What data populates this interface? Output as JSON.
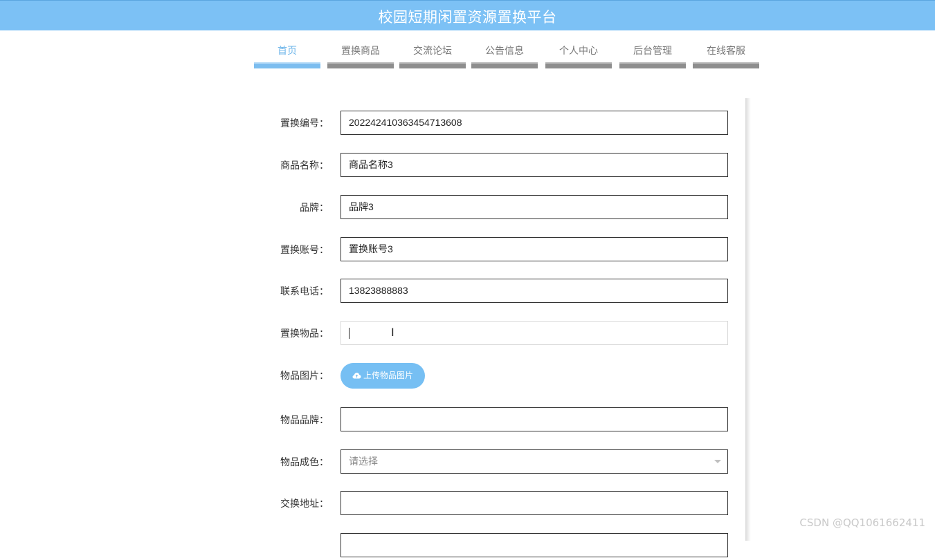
{
  "header": {
    "title": "校园短期闲置资源置换平台"
  },
  "nav": {
    "items": [
      {
        "label": "首页",
        "active": true
      },
      {
        "label": "置换商品"
      },
      {
        "label": "交流论坛"
      },
      {
        "label": "公告信息"
      },
      {
        "label": "个人中心"
      },
      {
        "label": "后台管理"
      },
      {
        "label": "在线客服"
      }
    ]
  },
  "form": {
    "exchange_no": {
      "label": "置换编号：",
      "value": "2022424103634547136​08"
    },
    "product_name": {
      "label": "商品名称：",
      "value": "商品名称3"
    },
    "brand": {
      "label": "品牌：",
      "value": "品牌3"
    },
    "exchange_account": {
      "label": "置换账号：",
      "value": "置换账号3"
    },
    "phone": {
      "label": "联系电话：",
      "value": "13823888883"
    },
    "exchange_item": {
      "label": "置换物品：",
      "value": ""
    },
    "item_image": {
      "label": "物品图片：",
      "button_label": "上传物品图片"
    },
    "item_brand": {
      "label": "物品品牌：",
      "value": ""
    },
    "item_condition": {
      "label": "物品成色：",
      "placeholder": "请选择"
    },
    "exchange_address": {
      "label": "交换地址：",
      "value": ""
    }
  },
  "watermark": "CSDN @QQ1061662411"
}
